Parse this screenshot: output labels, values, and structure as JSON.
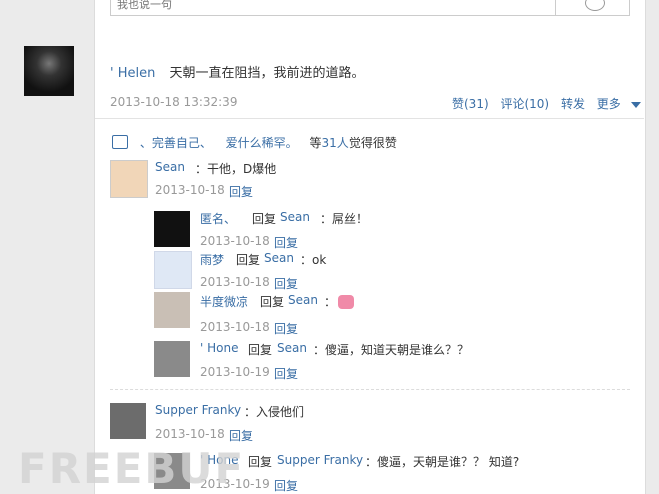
{
  "top_input": {
    "placeholder": "我也说一句"
  },
  "post": {
    "author": "' Helen",
    "text": "天朝一直在阻挡，我前进的道路。",
    "time": "2013-10-18 13:32:39",
    "actions": {
      "like": "赞(31)",
      "comment": "评论(10)",
      "forward": "转发",
      "more": "更多"
    }
  },
  "likes": {
    "names": [
      "、完善自己、",
      "爱什么稀罕。"
    ],
    "prefix_count": "等",
    "count": "31人",
    "suffix": "觉得很赞"
  },
  "comments": [
    {
      "name": "Sean",
      "text": "：干他，D爆他",
      "date": "2013-10-18",
      "reply": "回复"
    },
    {
      "name": "匿名、",
      "reply_word": "回复",
      "target": "Sean",
      "text": "：屌丝！",
      "date": "2013-10-18",
      "reply": "回复"
    },
    {
      "name": "雨梦",
      "reply_word": "回复",
      "target": "Sean",
      "text": "：ok",
      "date": "2013-10-18",
      "reply": "回复"
    },
    {
      "name": "半度微凉",
      "reply_word": "回复",
      "target": "Sean",
      "text": "：",
      "date": "2013-10-18",
      "reply": "回复"
    },
    {
      "name": "' Hone",
      "reply_word": "回复",
      "target": "Sean",
      "text": "：傻逼，知道天朝是谁么？？",
      "date": "2013-10-19",
      "reply": "回复"
    },
    {
      "name": "Supper Franky",
      "text": "：入侵他们",
      "date": "2013-10-18",
      "reply": "回复"
    },
    {
      "name": "' Hone",
      "reply_word": "回复",
      "target": "Supper Franky",
      "text": "：傻逼，天朝是谁？？ 知道?",
      "date": "2013-10-19",
      "reply": "回复"
    }
  ],
  "watermark": "FREEBUF"
}
